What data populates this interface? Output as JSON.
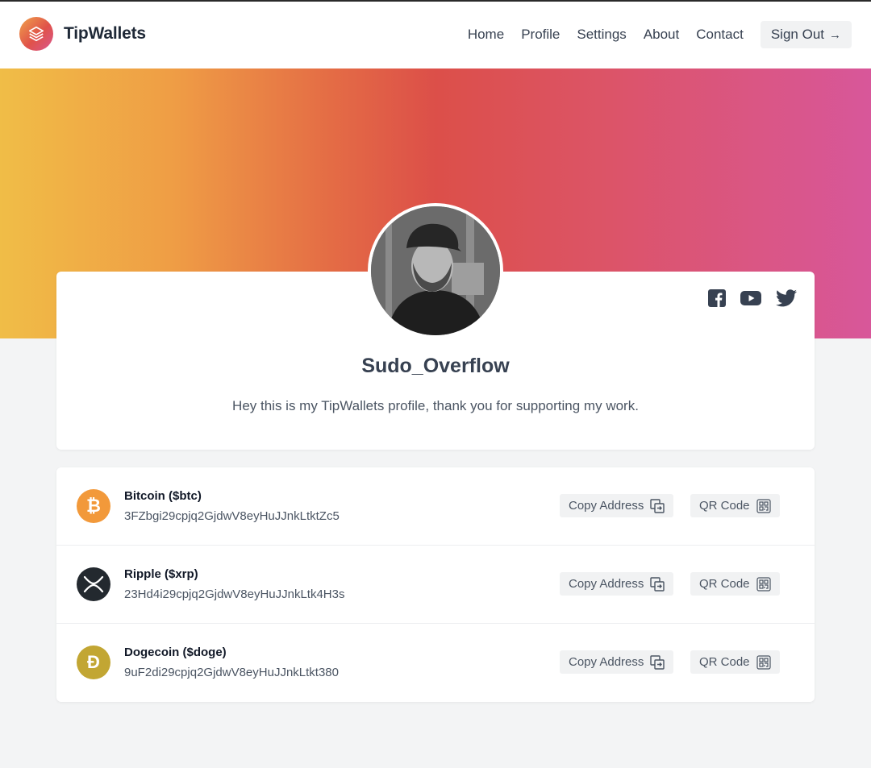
{
  "header": {
    "brand": "TipWallets",
    "nav": [
      "Home",
      "Profile",
      "Settings",
      "About",
      "Contact"
    ],
    "signout_label": "Sign Out",
    "signout_arrow": "→"
  },
  "profile": {
    "username": "Sudo_Overflow",
    "bio": "Hey this is my TipWallets profile, thank you for supporting my work.",
    "socials": [
      "facebook-icon",
      "youtube-icon",
      "twitter-icon"
    ]
  },
  "wallets": [
    {
      "name": "Bitcoin ($btc)",
      "address": "3FZbgi29cpjq2GjdwV8eyHuJJnkLtktZc5",
      "icon": "bitcoin-icon",
      "glyph": "₿",
      "color": "#f2993a",
      "copy_label": "Copy Address",
      "qr_label": "QR Code"
    },
    {
      "name": "Ripple ($xrp)",
      "address": "23Hd4i29cpjq2GjdwV8eyHuJJnkLtk4H3s",
      "icon": "ripple-icon",
      "glyph": "",
      "color": "#23292f",
      "copy_label": "Copy Address",
      "qr_label": "QR Code"
    },
    {
      "name": "Dogecoin ($doge)",
      "address": "9uF2di29cpjq2GjdwV8eyHuJJnkLtkt380",
      "icon": "dogecoin-icon",
      "glyph": "Ð",
      "color": "#c2a633",
      "copy_label": "Copy Address",
      "qr_label": "QR Code"
    }
  ],
  "colors": {
    "banner_start": "#f0bd47",
    "banner_mid": "#dc4f49",
    "banner_end": "#d8579a",
    "page_bg": "#f3f4f5"
  }
}
